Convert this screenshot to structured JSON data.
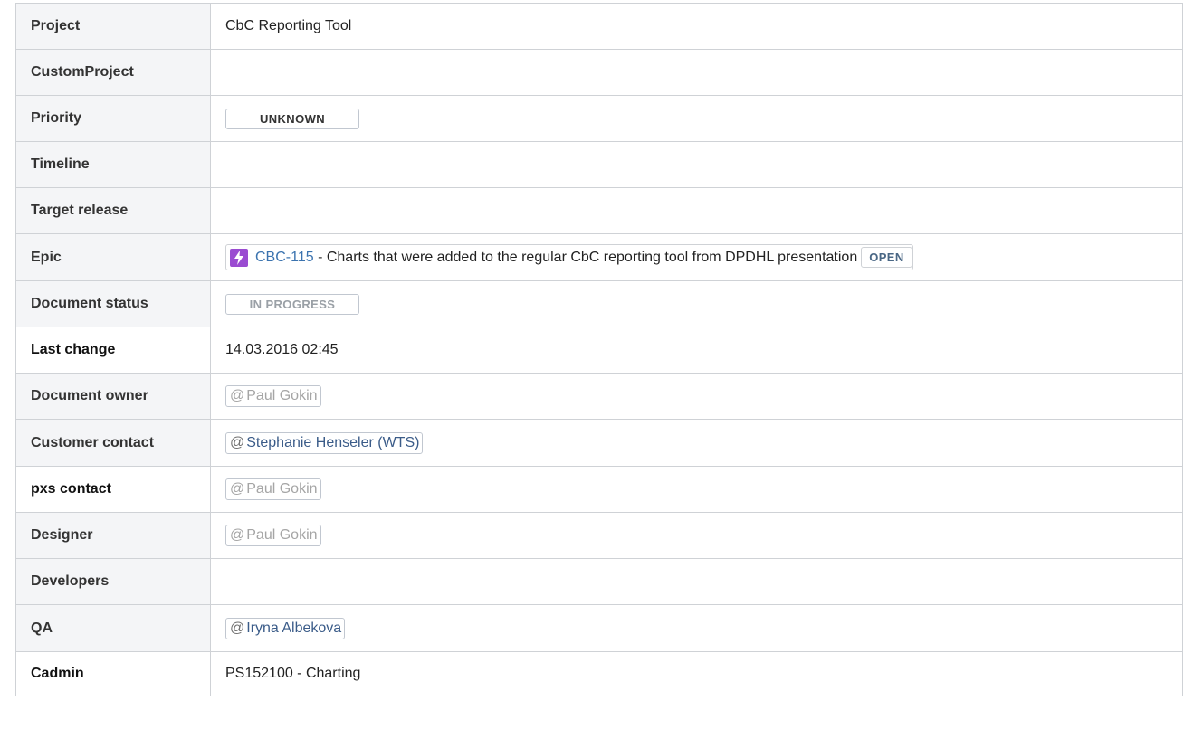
{
  "rows": {
    "project": {
      "label": "Project",
      "value": "CbC Reporting Tool"
    },
    "custom_project": {
      "label": "CustomProject",
      "value": ""
    },
    "priority": {
      "label": "Priority",
      "status": "UNKNOWN"
    },
    "timeline": {
      "label": "Timeline",
      "value": ""
    },
    "target_release": {
      "label": "Target release",
      "value": ""
    },
    "epic": {
      "label": "Epic",
      "icon": "epic-lightning-icon",
      "key": "CBC-115",
      "separator": " - ",
      "summary": "Charts that were added to the regular CbC reporting tool from DPDHL presentation",
      "status": "OPEN"
    },
    "document_status": {
      "label": "Document status",
      "status": "IN PROGRESS"
    },
    "last_change": {
      "label": "Last change",
      "value": "14.03.2016 02:45"
    },
    "document_owner": {
      "label": "Document owner",
      "at": "@",
      "user": "Paul Gokin"
    },
    "customer_contact": {
      "label": "Customer contact",
      "at": "@",
      "user": "Stephanie Henseler (WTS)"
    },
    "pxs_contact": {
      "label": "pxs contact",
      "at": "@",
      "user": "Paul Gokin"
    },
    "designer": {
      "label": "Designer",
      "at": "@",
      "user": "Paul Gokin"
    },
    "developers": {
      "label": "Developers",
      "value": ""
    },
    "qa": {
      "label": "QA",
      "at": "@",
      "user": "Iryna Albekova"
    },
    "cadmin": {
      "label": "Cadmin",
      "value": "PS152100 - Charting"
    }
  },
  "colors": {
    "header_bg": "#f4f5f7",
    "border": "#cfd2d6",
    "link": "#3b73af",
    "mention_active": "#3b5c89",
    "mention_inactive": "#a5a5a5",
    "epic_icon": "#9a4bd1"
  }
}
